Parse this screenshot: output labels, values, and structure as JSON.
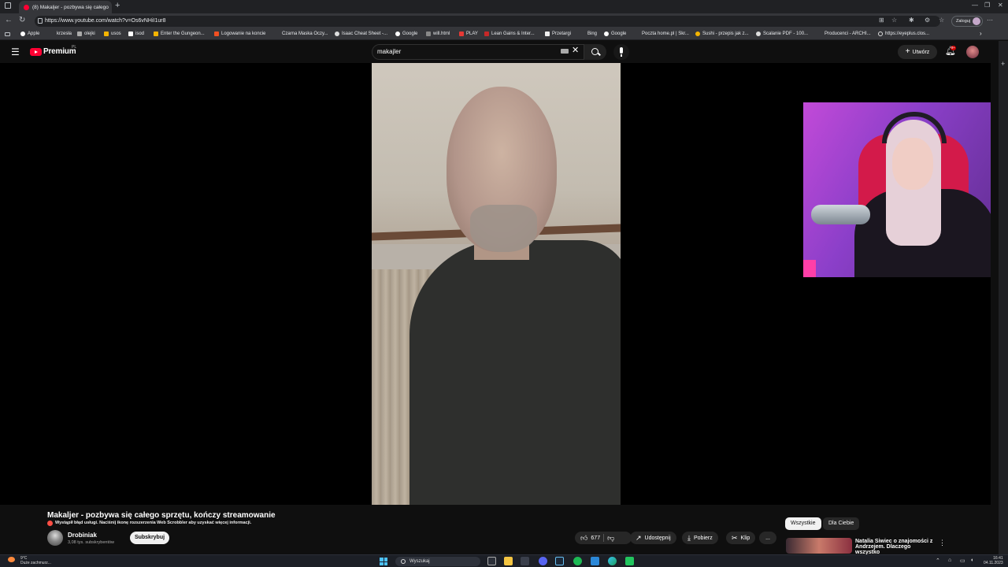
{
  "browser": {
    "tab_title": "(8) Makaljer - pozbywa się całego",
    "url": "https://www.youtube.com/watch?v=Os6vNHiI1ur8",
    "profile_label": "Zaloguj",
    "bookmarks": [
      "Apple",
      "krzesła",
      "olejki",
      "usos",
      "isod",
      "Enter the Gungeon...",
      "Logowanie na koncie",
      "Czarna Maska Oczy...",
      "Isaac Cheat Sheet -...",
      "Google",
      "will.html",
      "PLAY",
      "Lean Gains & Inter...",
      "Przetargi",
      "Bing",
      "Google",
      "Poczta home.pl | Skr...",
      "Sushi - przepis jak z...",
      "Scalanie PDF - 100...",
      "Producenci - ARCHI...",
      "https://eyeplus.clos..."
    ]
  },
  "header": {
    "brand": "Premium",
    "region": "PL",
    "search_value": "makajler",
    "create_label": "Utwórz",
    "notif_count": "9+"
  },
  "video": {
    "title": "Makaljer - pozbywa się całego sprzętu, kończy streamowanie",
    "error_text": "Wystąpił błąd usługi. Naciśnij ikonę rozszerzenia Web Scrobbler aby uzyskać więcej informacji.",
    "channel_name": "Drobiniak",
    "channel_subs": "3,08 tys. subskrybentów",
    "subscribe_label": "Subskrybuj",
    "likes": "677",
    "share_label": "Udostępnij",
    "download_label": "Pobierz",
    "clip_label": "Klip",
    "more_label": "..."
  },
  "recommendations": {
    "chip_all": "Wszystkie",
    "chip_for_you": "Dla Ciebie",
    "first_title": "Natalia Siwiec o znajomości z Andrzejem. Dlaczego wszystko"
  },
  "taskbar": {
    "temperature": "9°C",
    "weather_text": "Duże zachmurz...",
    "search_label": "Wyszukaj",
    "time": "16:41",
    "date": "04.11.2023"
  },
  "colors": {
    "accent": "#ff0033",
    "page_bg": "#0f0f0f",
    "chip_active": "#f1f1f1"
  }
}
